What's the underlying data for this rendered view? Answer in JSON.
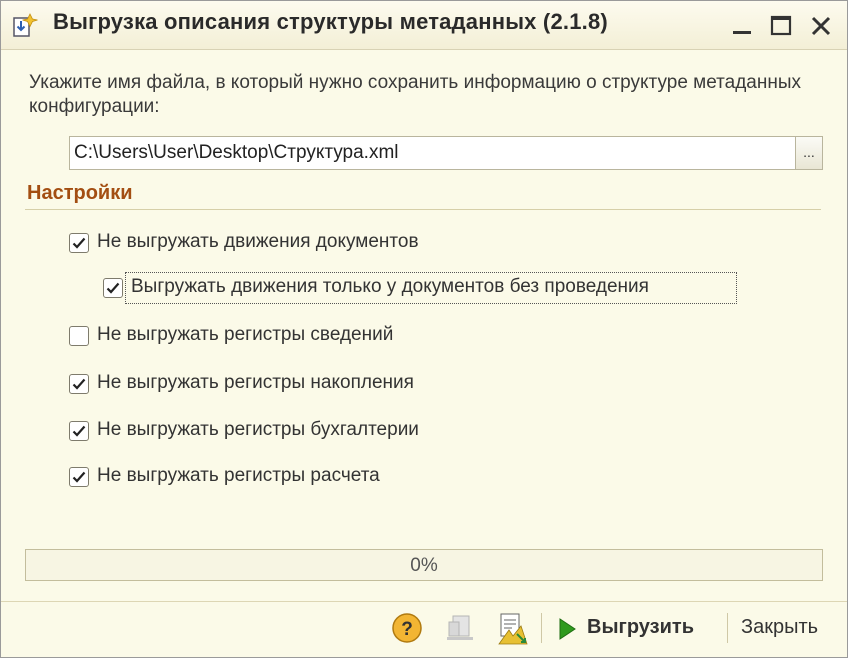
{
  "window": {
    "title": "Выгрузка описания структуры метаданных (2.1.8)"
  },
  "prompt_text": "Укажите имя файла, в который нужно сохранить информацию о структуре метаданных конфигурации:",
  "file_path": "C:\\Users\\User\\Desktop\\Структура.xml",
  "browse_label": "...",
  "settings": {
    "title": "Настройки",
    "options": [
      {
        "label": "Не выгружать движения документов",
        "checked": true
      },
      {
        "label": "Выгружать движения только у документов без проведения",
        "checked": true
      },
      {
        "label": "Не выгружать регистры сведений",
        "checked": false
      },
      {
        "label": "Не выгружать регистры накопления",
        "checked": true
      },
      {
        "label": "Не выгружать регистры бухгалтерии",
        "checked": true
      },
      {
        "label": "Не выгружать регистры расчета",
        "checked": true
      }
    ]
  },
  "progress": {
    "text": "0%",
    "fraction": 0
  },
  "footer": {
    "export_label": "Выгрузить",
    "close_label": "Закрыть"
  },
  "icons": {
    "app": "export-app-icon",
    "minimize": "minimize-icon",
    "maximize": "maximize-icon",
    "close": "close-icon",
    "help": "help-icon",
    "disabled_action": "document-disabled-icon",
    "open": "open-file-icon",
    "play": "play-icon"
  },
  "colors": {
    "background": "#fbfae8",
    "section_title": "#a34e12",
    "play_green": "#2f9a1e"
  }
}
